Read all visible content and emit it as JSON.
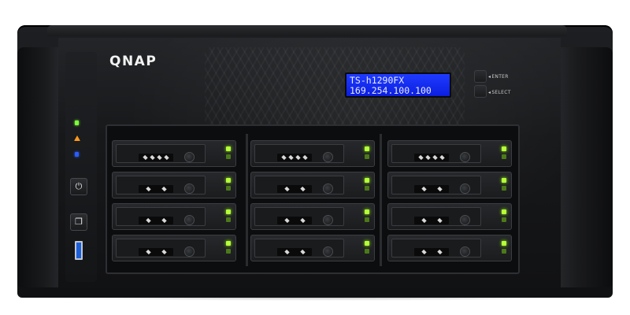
{
  "device": {
    "brand_logo": "QNAP",
    "lcd": {
      "line1": "TS-h1290FX",
      "line2": "169.254.100.100"
    },
    "buttons": {
      "enter_label": "ENTER",
      "select_label": "SELECT"
    },
    "colors": {
      "lcd_background": "#0b1ee0",
      "drive_led": "#b6ff3a",
      "usb_port": "#1d5fd8",
      "status_led_green": "#7cff3a",
      "status_led_orange": "#ff9a1a",
      "status_led_blue": "#2a5cff"
    },
    "icons": {
      "power_button": "power-icon",
      "copy_button": "copy-icon",
      "usb": "usb-port"
    },
    "drive_bays": {
      "columns": 3,
      "rows": 4,
      "count": 12
    }
  }
}
